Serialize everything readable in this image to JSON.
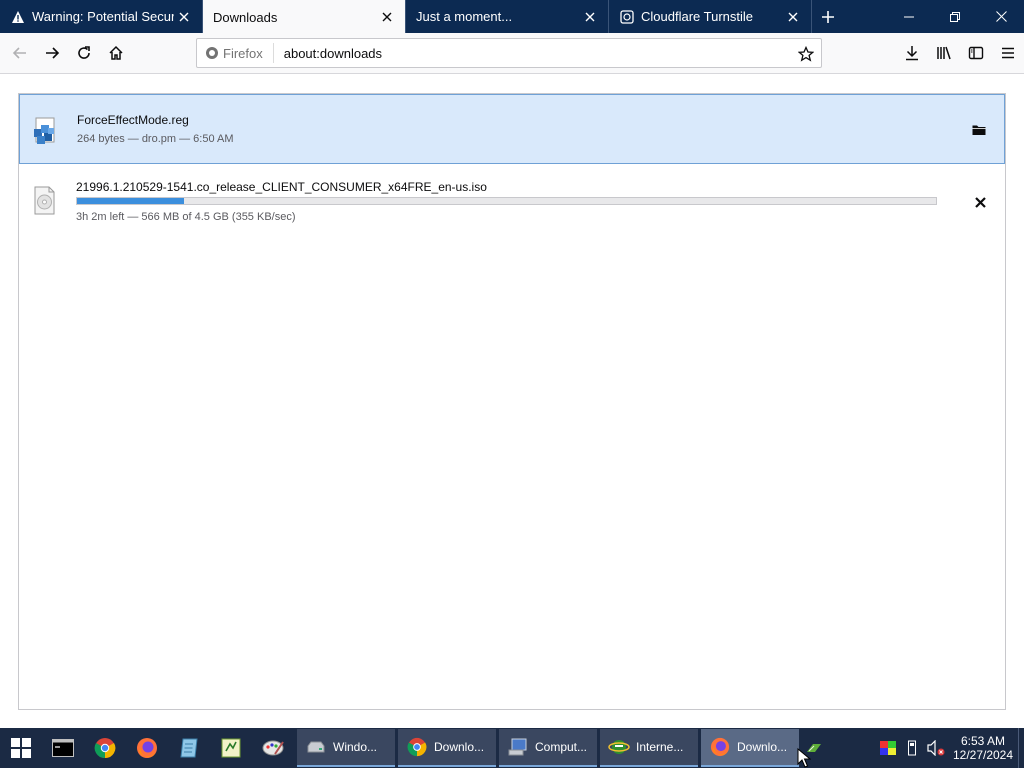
{
  "browser": {
    "tabs": [
      {
        "title": "Warning: Potential Security Risk Ahead",
        "icon": "warning-icon",
        "active": false
      },
      {
        "title": "Downloads",
        "icon": "",
        "active": true
      },
      {
        "title": "Just a moment...",
        "icon": "",
        "active": false
      },
      {
        "title": "Cloudflare Turnstile",
        "icon": "cloudflare-icon",
        "active": false
      }
    ],
    "url": {
      "identity_label": "Firefox",
      "text": "about:downloads"
    }
  },
  "downloads": [
    {
      "filename": "ForceEffectMode.reg",
      "status": "264 bytes — dro.pm — 6:50 AM",
      "icon": "registry-file-icon",
      "action": "open-folder",
      "selected": true
    },
    {
      "filename": "21996.1.210529-1541.co_release_CLIENT_CONSUMER_x64FRE_en-us.iso",
      "status": "3h 2m left — 566 MB of 4.5 GB (355 KB/sec)",
      "progress": 0.125,
      "icon": "disc-image-file-icon",
      "action": "cancel",
      "selected": false
    }
  ],
  "taskbar": {
    "pinned": [
      "start-icon",
      "terminal-icon",
      "chrome-icon",
      "firefox-icon",
      "notepad-icon",
      "excel-icon",
      "paint-icon"
    ],
    "tasks": [
      {
        "label": "Windo...",
        "icon": "drive-icon"
      },
      {
        "label": "Downlo...",
        "icon": "chrome-icon"
      },
      {
        "label": "Comput...",
        "icon": "computer-icon"
      },
      {
        "label": "Interne...",
        "icon": "ie-icon"
      },
      {
        "label": "Downlo...",
        "icon": "firefox-icon",
        "active": true
      }
    ],
    "clock": {
      "time": "6:53 AM",
      "date": "12/27/2024"
    }
  },
  "colors": {
    "tabstrip": "#0c2a52",
    "selected_row": "#d9e9fb",
    "progress": "#3c8fdd",
    "taskbar": "#1b2a44"
  }
}
